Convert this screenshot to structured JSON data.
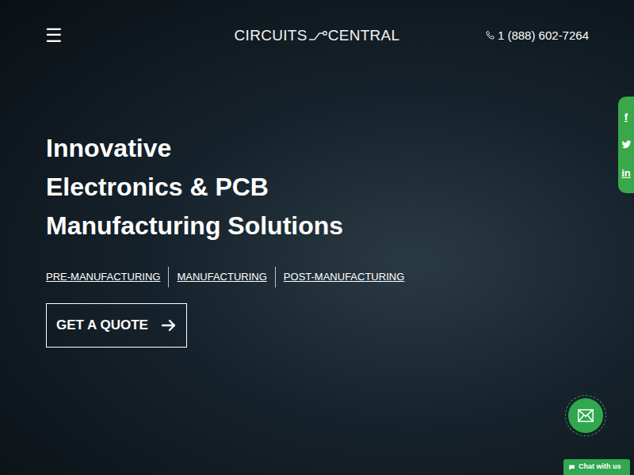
{
  "header": {
    "menu": "☰",
    "logo": {
      "left": "CIRCUITS",
      "right": "CENTRAL"
    },
    "phone": "1 (888) 602-7264"
  },
  "social": [
    {
      "kind": "text",
      "glyph": "f"
    },
    {
      "kind": "twitter"
    },
    {
      "kind": "text",
      "glyph": "in"
    }
  ],
  "hero": {
    "title": [
      "Innovative",
      "Electronics & PCB",
      "Manufacturing Solutions"
    ],
    "links": [
      "PRE-MANUFACTURING",
      "MANUFACTURING",
      "POST-MANUFACTURING"
    ],
    "button": "GET A QUOTE"
  },
  "chat": {
    "label": "Chat with us"
  }
}
